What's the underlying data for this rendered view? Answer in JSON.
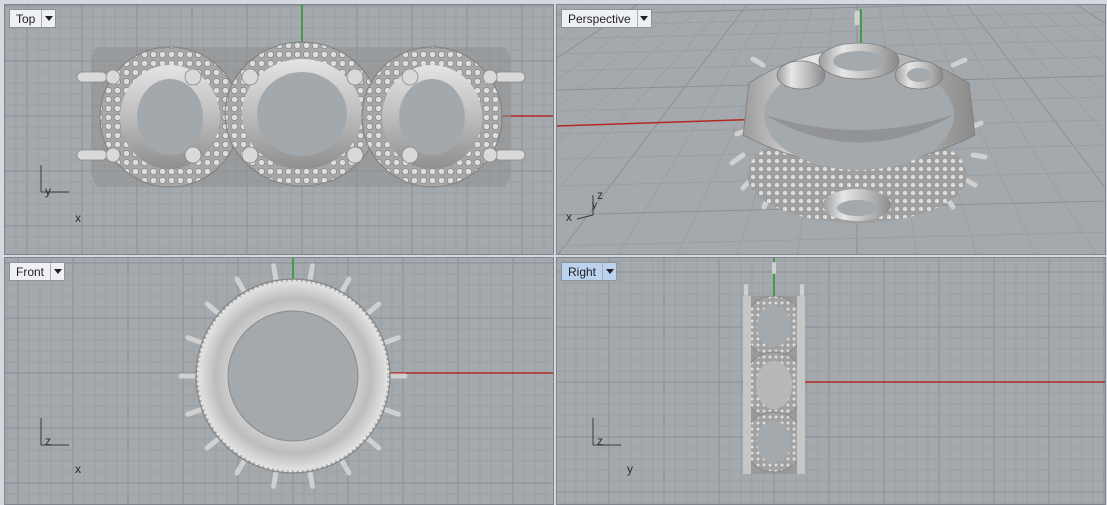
{
  "viewports": {
    "top": {
      "title": "Top",
      "axis_h": "x",
      "axis_v": "y"
    },
    "perspective": {
      "title": "Perspective",
      "axis_h": "x",
      "axis_v": "z",
      "axis_d": "y"
    },
    "front": {
      "title": "Front",
      "axis_h": "x",
      "axis_v": "z"
    },
    "right": {
      "title": "Right",
      "axis_h": "y",
      "axis_v": "z",
      "active": true
    }
  },
  "icons": {
    "viewport_menu": "chevron-down-icon"
  },
  "colors": {
    "viewport_bg": "#a4a9ae",
    "grid_minor": "#9a9fa4",
    "grid_major": "#8b9095",
    "axis_x": "#b22a22",
    "axis_y": "#1f9a2a",
    "active_tab": "#bcd3ef",
    "model_metal": "#c8c8c8"
  }
}
